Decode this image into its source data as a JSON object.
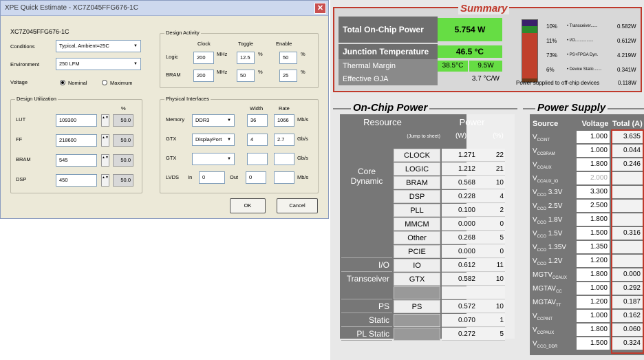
{
  "dialog": {
    "title": "XPE Quick Estimate - XC7Z045FFG676-1C",
    "device": "XC7Z045FFG676-1C",
    "conditions_label": "Conditions",
    "conditions_value": "Typical, Ambient=25C",
    "environment_label": "Environment",
    "environment_value": "250 LFM",
    "voltage_label": "Voltage",
    "voltage_nominal": "Nominal",
    "voltage_maximum": "Maximum",
    "design_activity": {
      "title": "Design Activity",
      "col_clock": "Clock",
      "col_toggle": "Toggle",
      "col_enable": "Enable",
      "rows": [
        {
          "label": "Logic",
          "clock": "200",
          "clock_unit": "MHz",
          "toggle": "12.5",
          "toggle_unit": "%",
          "enable": "50",
          "enable_unit": "%"
        },
        {
          "label": "BRAM",
          "clock": "200",
          "clock_unit": "MHz",
          "toggle": "50",
          "toggle_unit": "%",
          "enable": "25",
          "enable_unit": "%"
        }
      ]
    },
    "design_utilization": {
      "title": "Design Utilization",
      "pct_header": "%",
      "rows": [
        {
          "label": "LUT",
          "value": "109300",
          "pct": "50.0"
        },
        {
          "label": "FF",
          "value": "218600",
          "pct": "50.0"
        },
        {
          "label": "BRAM",
          "value": "545",
          "pct": "50.0"
        },
        {
          "label": "DSP",
          "value": "450",
          "pct": "50.0"
        }
      ]
    },
    "physical_interfaces": {
      "title": "Physical Interfaces",
      "col_width": "Width",
      "col_rate": "Rate",
      "rows": [
        {
          "label": "Memory",
          "value": "DDR3",
          "width": "36",
          "rate": "1066",
          "unit": "Mb/s"
        },
        {
          "label": "GTX",
          "value": "DisplayPort",
          "width": "4",
          "rate": "2.7",
          "unit": "Gb/s"
        },
        {
          "label": "GTX",
          "value": "",
          "width": "",
          "rate": "",
          "unit": "Gb/s"
        }
      ],
      "lvds": {
        "label": "LVDS",
        "in_label": "In",
        "in_value": "0",
        "out_label": "Out",
        "out_value": "0",
        "unit": "Mb/s"
      }
    },
    "ok": "OK",
    "cancel": "Cancel"
  },
  "summary": {
    "title": "Summary",
    "rows": [
      {
        "label": "Total On-Chip Power",
        "value": "5.754 W"
      },
      {
        "label": "Junction Temperature",
        "value": "46.5 °C"
      },
      {
        "label": "Thermal Margin",
        "value1": "38.5°C",
        "value2": "9.5W"
      },
      {
        "label": "Effective ΘJA",
        "value": "3.7 °C/W"
      }
    ],
    "legend": [
      {
        "pct": "10%",
        "name": "• Transceiver......",
        "watts": "0.582W",
        "color": "#3a1f6b"
      },
      {
        "pct": "11%",
        "name": "• I/O................",
        "watts": "0.612W",
        "color": "#2d8a2d"
      },
      {
        "pct": "73%",
        "name": "• PS+FPGA Dyn.",
        "watts": "4.219W",
        "color": "#c0402c"
      },
      {
        "pct": "6%",
        "name": "• Device Static.......",
        "watts": "0.341W",
        "color": "#6a3a1a"
      }
    ],
    "offchip_label": "Power supplied to off-chip devices",
    "offchip_watts": "0.118W",
    "bar_fractions": [
      0.1,
      0.11,
      0.73,
      0.06
    ]
  },
  "on_chip": {
    "title": "On-Chip Power",
    "h_resource": "Resource",
    "h_power": "Power",
    "jump": "(Jump to sheet)",
    "h_w": "(W)",
    "h_pct": "(%)",
    "groups": [
      {
        "label": "Core Dynamic",
        "rows": [
          {
            "name": "CLOCK",
            "w": "1.271",
            "pct": "22"
          },
          {
            "name": "LOGIC",
            "w": "1.212",
            "pct": "21"
          },
          {
            "name": "BRAM",
            "w": "0.568",
            "pct": "10"
          },
          {
            "name": "DSP",
            "w": "0.228",
            "pct": "4"
          },
          {
            "name": "PLL",
            "w": "0.100",
            "pct": "2"
          },
          {
            "name": "MMCM",
            "w": "0.000",
            "pct": "0"
          },
          {
            "name": "Other",
            "w": "0.268",
            "pct": "5"
          },
          {
            "name": "PCIE",
            "w": "0.000",
            "pct": "0"
          }
        ]
      },
      {
        "label": "I/O",
        "rows": [
          {
            "name": "IO",
            "w": "0.612",
            "pct": "11"
          }
        ]
      },
      {
        "label": "Transceiver",
        "rows": [
          {
            "name": "GTX",
            "w": "0.582",
            "pct": "10"
          },
          {
            "name": "",
            "w": "",
            "pct": ""
          }
        ]
      },
      {
        "label": "PS Dynamic",
        "rows": [
          {
            "name": "PS",
            "w": "0.572",
            "pct": "10"
          }
        ]
      },
      {
        "label": "Static",
        "rows": [
          {
            "name": "",
            "w": "0.070",
            "pct": "1"
          }
        ]
      },
      {
        "label": "PL Static",
        "rows": [
          {
            "name": "",
            "w": "0.272",
            "pct": "5"
          }
        ]
      }
    ]
  },
  "power_supply": {
    "title": "Power Supply",
    "h_source": "Source",
    "h_voltage": "Voltage",
    "h_total": "Total (A)",
    "rows": [
      {
        "base": "V",
        "sub": "CCINT",
        "v": "1.000",
        "a": "3.635"
      },
      {
        "base": "V",
        "sub": "CCBRAM",
        "v": "1.000",
        "a": "0.044"
      },
      {
        "base": "V",
        "sub": "CCAUX",
        "v": "1.800",
        "a": "0.246"
      },
      {
        "base": "V",
        "sub": "CCAUX_IO",
        "v": "2.000",
        "a": "",
        "dim": true
      },
      {
        "base": "V",
        "sub": "CCO",
        "tail": " 3.3V",
        "v": "3.300",
        "a": ""
      },
      {
        "base": "V",
        "sub": "CCO",
        "tail": " 2.5V",
        "v": "2.500",
        "a": ""
      },
      {
        "base": "V",
        "sub": "CCO",
        "tail": " 1.8V",
        "v": "1.800",
        "a": ""
      },
      {
        "base": "V",
        "sub": "CCO",
        "tail": " 1.5V",
        "v": "1.500",
        "a": "0.316"
      },
      {
        "base": "V",
        "sub": "CCO",
        "tail": " 1.35V",
        "v": "1.350",
        "a": ""
      },
      {
        "base": "V",
        "sub": "CCO",
        "tail": " 1.2V",
        "v": "1.200",
        "a": ""
      },
      {
        "base": "MGTV",
        "sub": "CCAUX",
        "v": "1.800",
        "a": "0.000"
      },
      {
        "base": "MGTAV",
        "sub": "CC",
        "v": "1.000",
        "a": "0.292"
      },
      {
        "base": "MGTAV",
        "sub": "TT",
        "v": "1.200",
        "a": "0.187"
      },
      {
        "base": "V",
        "sub": "CCPINT",
        "v": "1.000",
        "a": "0.162"
      },
      {
        "base": "V",
        "sub": "CCPAUX",
        "v": "1.800",
        "a": "0.060"
      },
      {
        "base": "V",
        "sub": "CCO_DDR",
        "v": "1.500",
        "a": "0.324"
      }
    ]
  }
}
